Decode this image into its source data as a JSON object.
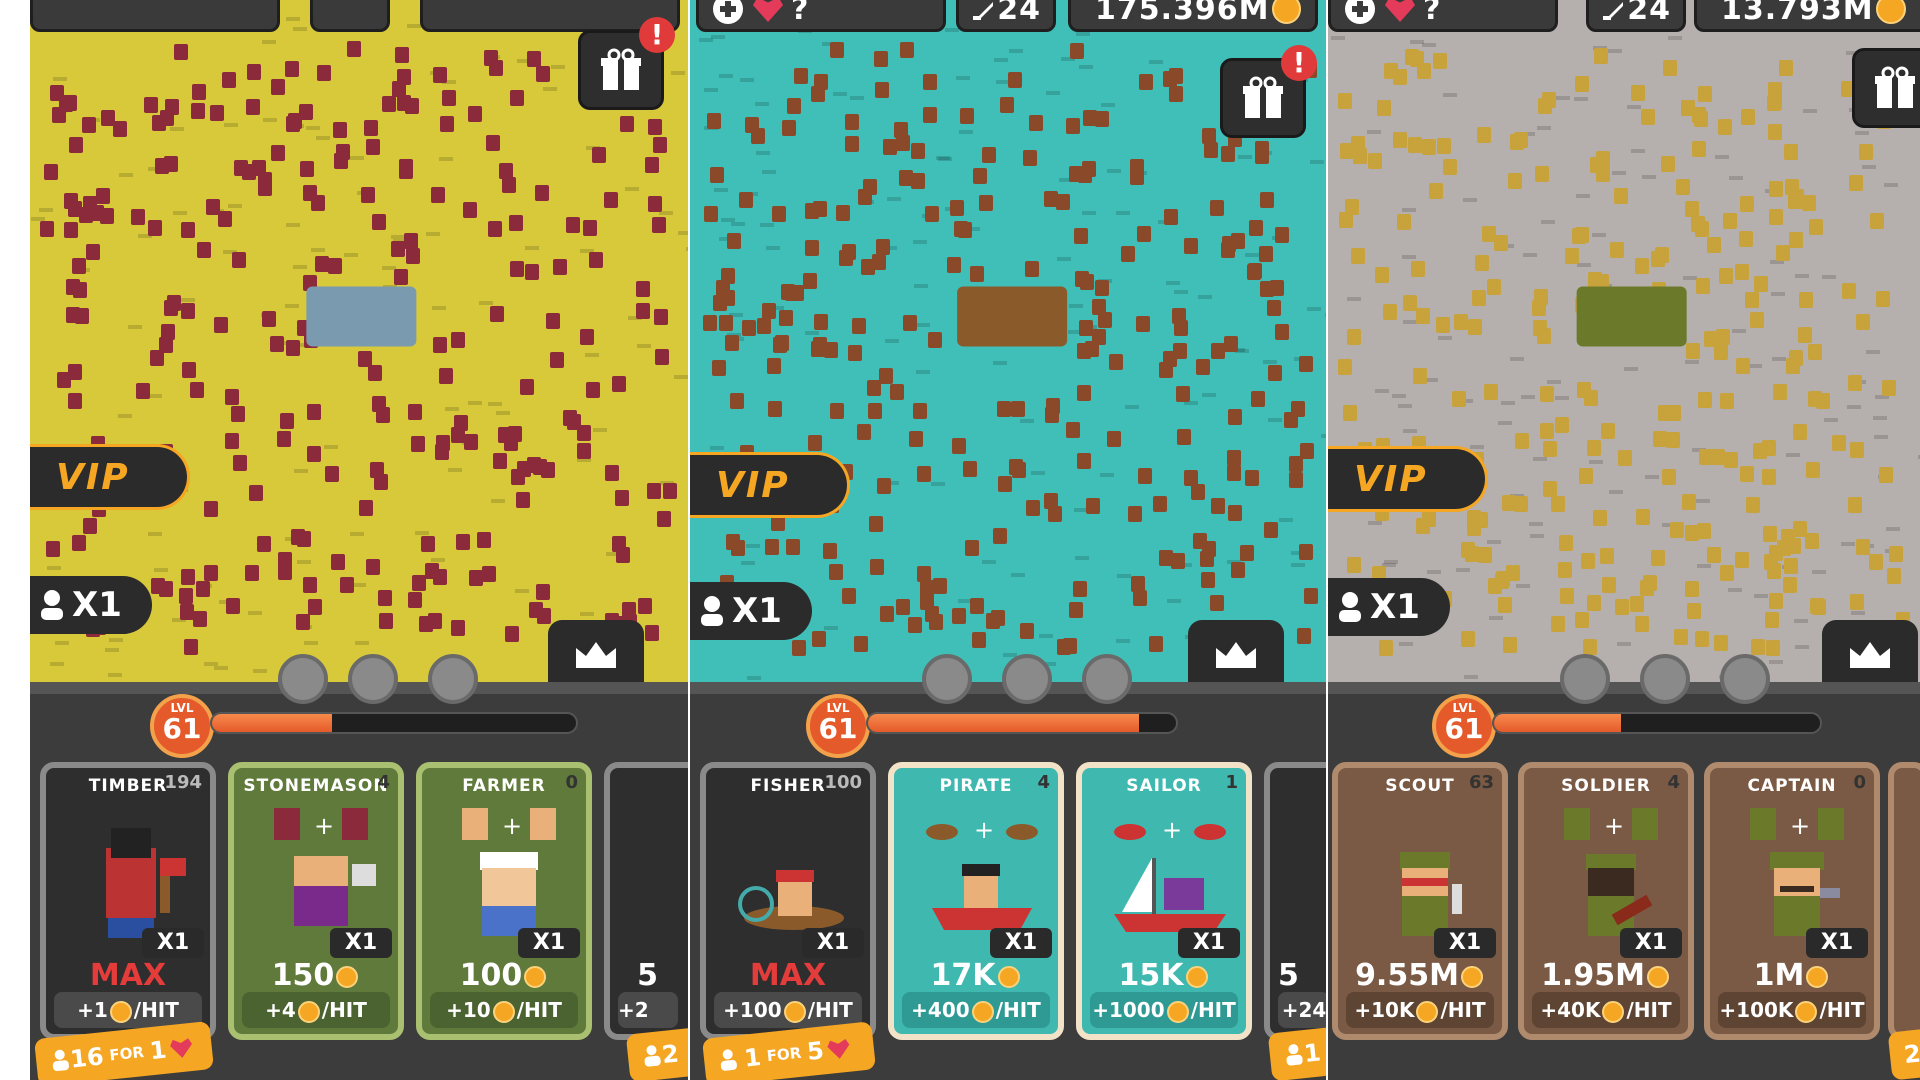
{
  "panels": [
    {
      "theme": "field",
      "bg": "#d8c93a",
      "unit_color": "#8a2a3a",
      "topbar": [],
      "gift_alert": "!",
      "vip_label": "VIP",
      "multiplier": "X1",
      "level_label": "LVL",
      "level": "61",
      "xp_progress": 0.33,
      "cards": [
        {
          "name": "TIMBER",
          "count": "194",
          "price": "MAX",
          "hit": "+1",
          "hit_suffix": "/HIT",
          "x": "X1",
          "style": "locked"
        },
        {
          "name": "STONEMASON",
          "count": "4",
          "price": "150",
          "hit": "+4",
          "hit_suffix": "/HIT",
          "x": "X1",
          "style": "green"
        },
        {
          "name": "FARMER",
          "count": "0",
          "price": "100",
          "hit": "+10",
          "hit_suffix": "/HIT",
          "x": "X1",
          "style": "green"
        },
        {
          "name": "",
          "count": "",
          "price": "5",
          "hit": "+2",
          "hit_suffix": "",
          "x": "",
          "style": "partial"
        }
      ],
      "offer": {
        "count": "16",
        "for": "FOR",
        "cost": "1"
      },
      "offer2": "2"
    },
    {
      "theme": "sea",
      "bg": "#3fbfb8",
      "unit_color": "#8a4a2a",
      "topbar": [
        "?",
        "24",
        "175.396M"
      ],
      "gift_alert": "!",
      "vip_label": "VIP",
      "multiplier": "X1",
      "level_label": "LVL",
      "level": "61",
      "xp_progress": 0.88,
      "cards": [
        {
          "name": "FISHER",
          "count": "100",
          "price": "MAX",
          "hit": "+100",
          "hit_suffix": "/HIT",
          "x": "X1",
          "style": "locked"
        },
        {
          "name": "PIRATE",
          "count": "4",
          "price": "17K",
          "hit": "+400",
          "hit_suffix": "/HIT",
          "x": "X1",
          "style": "teal"
        },
        {
          "name": "SAILOR",
          "count": "1",
          "price": "15K",
          "hit": "+1000",
          "hit_suffix": "/HIT",
          "x": "X1",
          "style": "teal"
        },
        {
          "name": "",
          "count": "",
          "price": "5",
          "hit": "+24",
          "hit_suffix": "",
          "x": "",
          "style": "partial"
        }
      ],
      "offer": {
        "count": "1",
        "for": "FOR",
        "cost": "5"
      },
      "offer2": "1"
    },
    {
      "theme": "fort",
      "bg": "#b5b0ad",
      "unit_color": "#c8a23a",
      "topbar": [
        "?",
        "24",
        "13.793M"
      ],
      "gift_alert": "",
      "vip_label": "VIP",
      "multiplier": "X1",
      "level_label": "LVL",
      "level": "61",
      "xp_progress": 0.39,
      "cards": [
        {
          "name": "SCOUT",
          "count": "63",
          "price": "9.55M",
          "hit": "+10K",
          "hit_suffix": "/HIT",
          "x": "X1",
          "style": "brown"
        },
        {
          "name": "SOLDIER",
          "count": "4",
          "price": "1.95M",
          "hit": "+40K",
          "hit_suffix": "/HIT",
          "x": "X1",
          "style": "brown"
        },
        {
          "name": "CAPTAIN",
          "count": "0",
          "price": "1M",
          "hit": "+100K",
          "hit_suffix": "/HIT",
          "x": "X1",
          "style": "brown"
        }
      ],
      "offer": null,
      "offer2": "2"
    }
  ]
}
